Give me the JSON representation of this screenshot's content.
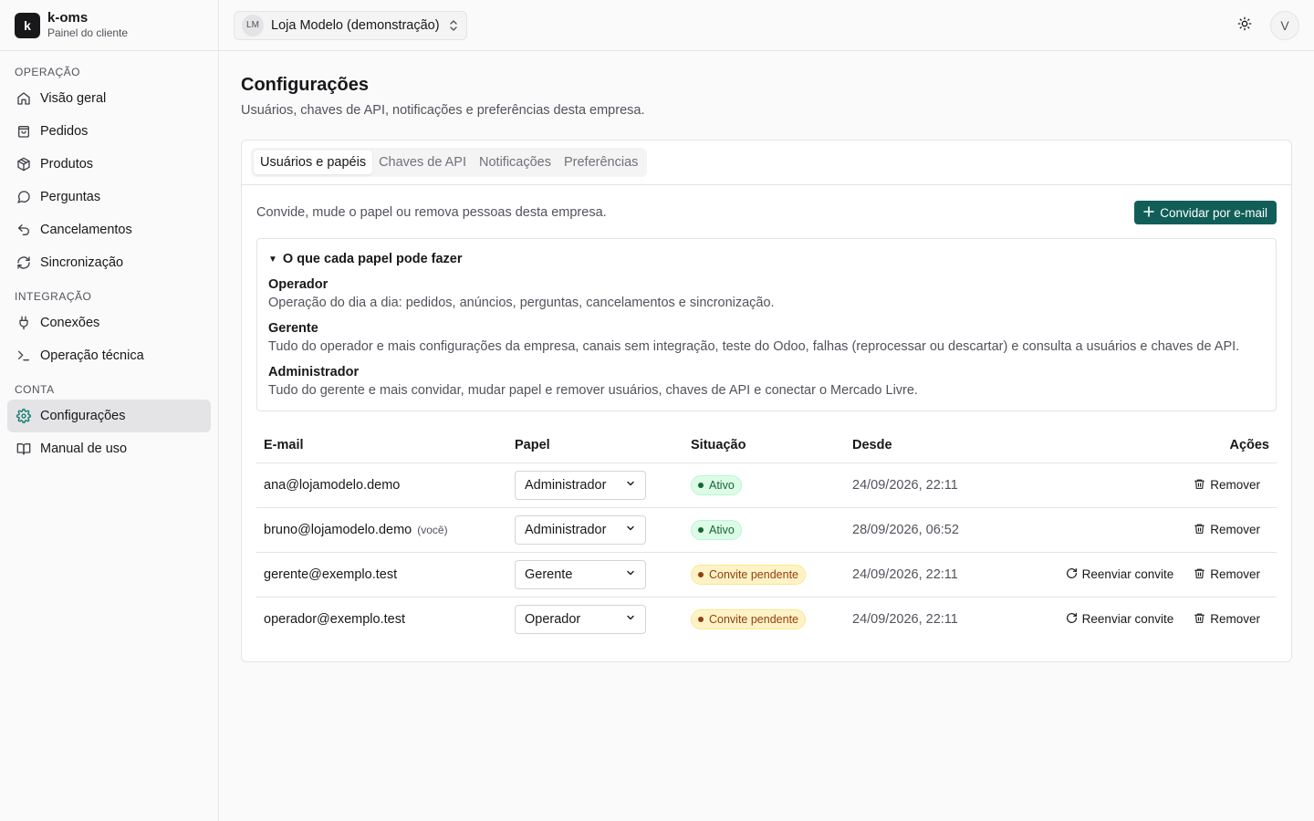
{
  "brand": {
    "logo_letter": "k",
    "name": "k-oms",
    "subtitle": "Painel do cliente"
  },
  "sidebar": {
    "groups": [
      {
        "label": "OPERAÇÃO",
        "items": [
          {
            "label": "Visão geral",
            "icon": "home-icon"
          },
          {
            "label": "Pedidos",
            "icon": "shopping-bag-icon"
          },
          {
            "label": "Produtos",
            "icon": "package-icon"
          },
          {
            "label": "Perguntas",
            "icon": "message-circle-icon"
          },
          {
            "label": "Cancelamentos",
            "icon": "undo-icon"
          },
          {
            "label": "Sincronização",
            "icon": "refresh-icon"
          }
        ]
      },
      {
        "label": "INTEGRAÇÃO",
        "items": [
          {
            "label": "Conexões",
            "icon": "plug-icon"
          },
          {
            "label": "Operação técnica",
            "icon": "terminal-icon"
          }
        ]
      },
      {
        "label": "CONTA",
        "items": [
          {
            "label": "Configurações",
            "icon": "gear-icon",
            "active": true
          },
          {
            "label": "Manual de uso",
            "icon": "book-icon"
          }
        ]
      }
    ]
  },
  "topbar": {
    "company_initials": "LM",
    "company_name": "Loja Modelo (demonstração)",
    "avatar_letter": "V"
  },
  "page": {
    "title": "Configurações",
    "description": "Usuários, chaves de API, notificações e preferências desta empresa."
  },
  "tabs": [
    {
      "label": "Usuários e papéis",
      "active": true
    },
    {
      "label": "Chaves de API"
    },
    {
      "label": "Notificações"
    },
    {
      "label": "Preferências"
    }
  ],
  "users_tab": {
    "description": "Convide, mude o papel ou remova pessoas desta empresa.",
    "invite_button": "Convidar por e-mail",
    "roles_summary": "O que cada papel pode fazer",
    "roles": [
      {
        "name": "Operador",
        "description": "Operação do dia a dia: pedidos, anúncios, perguntas, cancelamentos e sincronização."
      },
      {
        "name": "Gerente",
        "description": "Tudo do operador e mais configurações da empresa, canais sem integração, teste do Odoo, falhas (reprocessar ou descartar) e consulta a usuários e chaves de API."
      },
      {
        "name": "Administrador",
        "description": "Tudo do gerente e mais convidar, mudar papel e remover usuários, chaves de API e conectar o Mercado Livre."
      }
    ],
    "table": {
      "headers": {
        "email": "E-mail",
        "role": "Papel",
        "status": "Situação",
        "since": "Desde",
        "actions": "Ações"
      },
      "rows": [
        {
          "email": "ana@lojamodelo.demo",
          "you": "",
          "role": "Administrador",
          "status": "Ativo",
          "status_kind": "ativo",
          "since": "24/09/2026, 22:11",
          "resend": "",
          "remove": "Remover"
        },
        {
          "email": "bruno@lojamodelo.demo",
          "you": "(você)",
          "role": "Administrador",
          "status": "Ativo",
          "status_kind": "ativo",
          "since": "28/09/2026, 06:52",
          "resend": "",
          "remove": "Remover"
        },
        {
          "email": "gerente@exemplo.test",
          "you": "",
          "role": "Gerente",
          "status": "Convite pendente",
          "status_kind": "pendente",
          "since": "24/09/2026, 22:11",
          "resend": "Reenviar convite",
          "remove": "Remover"
        },
        {
          "email": "operador@exemplo.test",
          "you": "",
          "role": "Operador",
          "status": "Convite pendente",
          "status_kind": "pendente",
          "since": "24/09/2026, 22:11",
          "resend": "Reenviar convite",
          "remove": "Remover"
        }
      ]
    }
  },
  "colors": {
    "accent": "#115e59",
    "active_nav_bg": "#e4e4e7",
    "ativo_bg": "#dcfce7",
    "pendente_bg": "#fef3c7"
  }
}
